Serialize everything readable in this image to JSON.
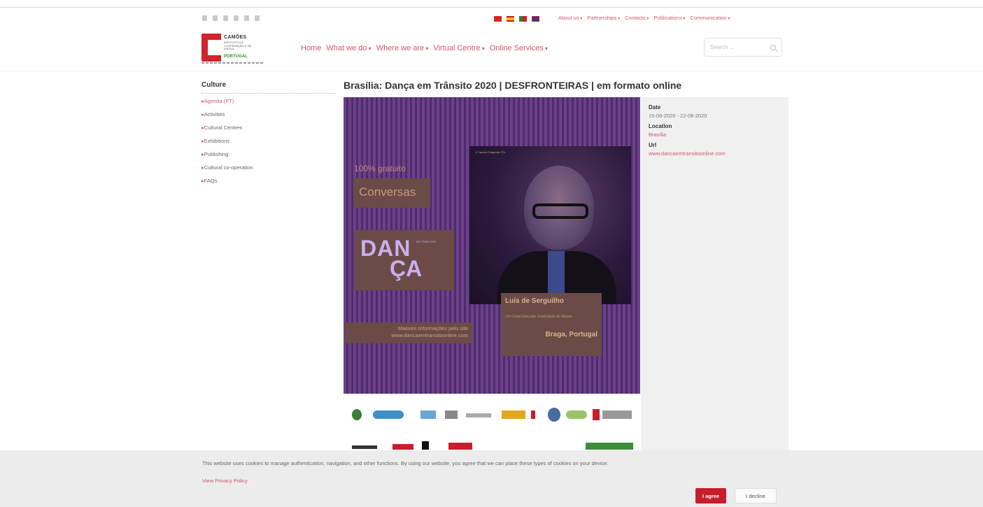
{
  "social_icons": [
    "facebook-icon",
    "twitter-icon",
    "instagram-icon",
    "linkedin-icon",
    "youtube-icon",
    "rss-icon"
  ],
  "language_flags": [
    {
      "name": "china-flag-icon",
      "color": "#d9261c"
    },
    {
      "name": "spain-flag-icon",
      "color": "#e8b31a"
    },
    {
      "name": "portugal-flag-icon",
      "color": "#1a8a3a"
    },
    {
      "name": "uk-flag-icon",
      "color": "#27418c"
    }
  ],
  "top_menu": [
    "About us",
    "Partnerships",
    "Contacts",
    "Publications",
    "Communication"
  ],
  "logo": {
    "name": "CAMÕES",
    "subtitle": "INSTITUTO DA COOPERAÇÃO E DA LÍNGUA",
    "country": "PORTUGAL"
  },
  "main_nav": [
    {
      "label": "Home",
      "dropdown": false
    },
    {
      "label": "What we do",
      "dropdown": true
    },
    {
      "label": "Where we are",
      "dropdown": true
    },
    {
      "label": "Virtual Centre",
      "dropdown": true
    },
    {
      "label": "Online Services",
      "dropdown": true
    }
  ],
  "search": {
    "placeholder": "Search ..."
  },
  "sidebar": {
    "title": "Culture",
    "items": [
      "Agenda (PT)",
      "Activities",
      "Cultural Centres",
      "Exhibitions",
      "Publishing",
      "Cultural co-operation",
      "FAQs"
    ]
  },
  "page_title": "Brasília: Dança em Trânsito 2020 | DESFRONTEIRAS | em formato online",
  "poster": {
    "tag": "100% gratuito",
    "conversas": "Conversas",
    "danca_line1": "DAN",
    "danca_line2": "ÇA",
    "danca_small": "EM TRAN SITO",
    "info_line1": "Maiores Informações pelo site",
    "info_line2": "www.dancaemtransitoonline.com",
    "photo_small": "17 Agosto Segunda 17h",
    "person_name": "Luís de Serguilho",
    "person_sub": "Um Corpo Dançado Criatividade do Mundo",
    "person_city": "Braga, Portugal"
  },
  "info": {
    "date_label": "Date",
    "date_value": "15-08-2020 - 22-08-2020",
    "location_label": "Location",
    "location_value": "Brasília",
    "url_label": "Url",
    "url_value": "www.dancaemtransitoonline.com"
  },
  "cookie": {
    "message": "This website uses cookies to manage authentication, navigation, and other functions. By using our website, you agree that we can place these types of cookies on your device.",
    "privacy_link": "View Privacy Policy",
    "agree": "I agree",
    "decline": "I decline"
  },
  "colors": {
    "accent": "#d2556a",
    "brand_red": "#c81e2b",
    "poster_purple": "#5b3478"
  }
}
